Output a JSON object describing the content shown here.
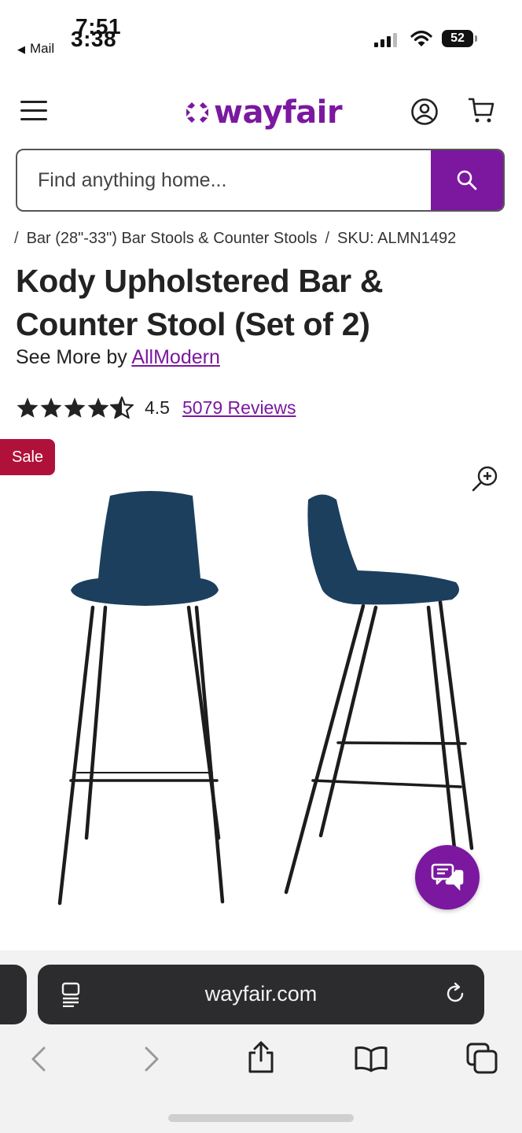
{
  "status_bar": {
    "time_overlay_a": "7:51",
    "time_overlay_b": "3:38",
    "back_app": "Mail",
    "battery": "52"
  },
  "header": {
    "logo_text": "wayfair",
    "brand_color": "#7b189f"
  },
  "search": {
    "placeholder": "Find anything home..."
  },
  "breadcrumb": {
    "items": [
      "Bar (28\"-33\") Bar Stools & Counter Stools",
      "SKU: ALMN1492"
    ]
  },
  "product": {
    "title": "Kody Upholstered Bar & Counter Stool (Set of 2)",
    "see_more_prefix": "See More by",
    "brand": "AllModern",
    "rating": "4.5",
    "rating_value": 4.5,
    "reviews": "5079 Reviews",
    "sale_badge": "Sale",
    "sale_color": "#b0113a"
  },
  "browser": {
    "url": "wayfair.com"
  },
  "icons": [
    "menu-icon",
    "account-icon",
    "cart-icon",
    "search-icon",
    "zoom-in-icon",
    "chat-icon",
    "reader-icon",
    "reload-icon",
    "back-icon",
    "forward-icon",
    "share-icon",
    "bookmarks-icon",
    "tabs-icon"
  ]
}
